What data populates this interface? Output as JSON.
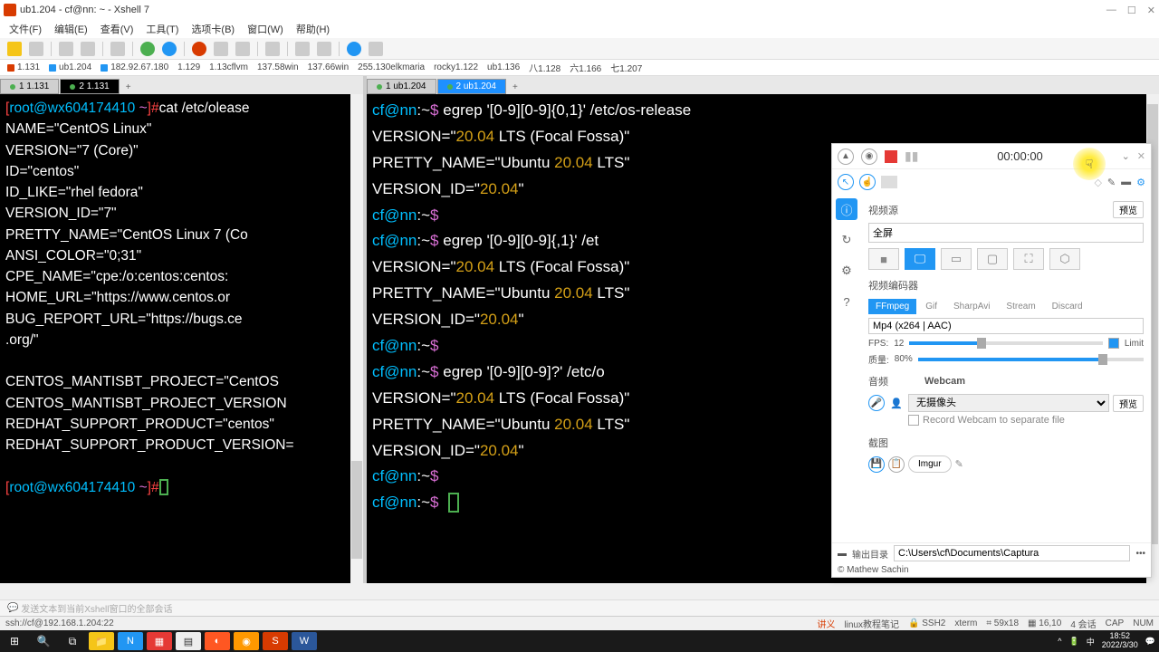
{
  "window": {
    "title": "ub1.204 - cf@nn: ~ - Xshell 7",
    "min": "—",
    "max": "☐",
    "close": "✕"
  },
  "menu": [
    "文件(F)",
    "编辑(E)",
    "查看(V)",
    "工具(T)",
    "选项卡(B)",
    "窗口(W)",
    "帮助(H)"
  ],
  "sessions": [
    "1.131",
    "ub1.204",
    "182.92.67.180",
    "1.129",
    "1.13cflvm",
    "137.58win",
    "137.66win",
    "255.130elkmaria",
    "rocky1.122",
    "ub1.136",
    "八1.128",
    "六1.166",
    "七1.207"
  ],
  "left_tabs": {
    "t1": "1 1.131",
    "t2": "2 1.131",
    "add": "+"
  },
  "right_tabs": {
    "t1": "1 ub1.204",
    "t2": "2 ub1.204",
    "add": "+"
  },
  "left_term": {
    "p1a": "[",
    "p1b": "root@wx604174410",
    "p1c": " ~",
    "p1d": "]#",
    "cmd1": "cat /etc/olease",
    "l1": "NAME=\"CentOS Linux\"",
    "l2": "VERSION=\"7 (Core)\"",
    "l3": "ID=\"centos\"",
    "l4": "ID_LIKE=\"rhel fedora\"",
    "l5": "VERSION_ID=\"7\"",
    "l6": "PRETTY_NAME=\"CentOS Linux 7 (Co",
    "l7": "ANSI_COLOR=\"0;31\"",
    "l8": "CPE_NAME=\"cpe:/o:centos:centos:",
    "l9": "HOME_URL=\"https://www.centos.or",
    "l10": "BUG_REPORT_URL=\"https://bugs.ce",
    "l11": ".org/\"",
    "l12": "CENTOS_MANTISBT_PROJECT=\"CentOS",
    "l13": "CENTOS_MANTISBT_PROJECT_VERSION",
    "l14": "REDHAT_SUPPORT_PRODUCT=\"centos\"",
    "l15": "REDHAT_SUPPORT_PRODUCT_VERSION="
  },
  "right_term": {
    "user": "cf@nn",
    "path": ":~",
    "dollar": "$",
    "c1": " egrep '[0-9][0-9]{0,1}' /etc/os-release",
    "v1a": "VERSION=\"",
    "v1n": "20.04",
    "v1b": " LTS (Focal Fossa)\"",
    "p1a": "PRETTY_NAME=\"Ubuntu ",
    "p1n": "20.04",
    "p1b": " LTS\"",
    "i1a": "VERSION_ID=\"",
    "i1n": "20.04",
    "i1b": "\"",
    "c2": " egrep '[0-9][0-9]{,1}' /et",
    "c3": " egrep '[0-9][0-9]?' /etc/o"
  },
  "captura": {
    "time": "00:00:00",
    "video_src": "视频源",
    "preview": "预览",
    "fullscreen": "全屏",
    "encoder": "视频编码器",
    "enc_tabs": [
      "FFmpeg",
      "Gif",
      "SharpAvi",
      "Stream",
      "Discard"
    ],
    "format": "Mp4 (x264 | AAC)",
    "fps_label": "FPS:",
    "fps_val": "12",
    "limit": "Limit",
    "quality_label": "质量:",
    "quality_val": "80%",
    "audio": "音频",
    "webcam": "Webcam",
    "webcam_sel": "无摄像头",
    "rec_sep": "Record Webcam to separate file",
    "screenshot": "截图",
    "imgur": "Imgur",
    "outdir_label": "输出目录",
    "outdir": "C:\\Users\\cf\\Documents\\Captura",
    "credit": "© Mathew Sachin",
    "dots": "•••"
  },
  "bottom": {
    "hint": "发送文本到当前Xshell窗口的全部会话"
  },
  "status": {
    "conn": "ssh://cf@192.168.1.204:22",
    "ssh": "SSH2",
    "term": "xterm",
    "size": "59x18",
    "pos": "16,10",
    "sess": "4 会话",
    "cap": "CAP",
    "num": "NUM",
    "talk": "讲义",
    "notes": "linux教程笔记"
  },
  "taskbar": {
    "time": "18:52",
    "date": "2022/3/30"
  }
}
